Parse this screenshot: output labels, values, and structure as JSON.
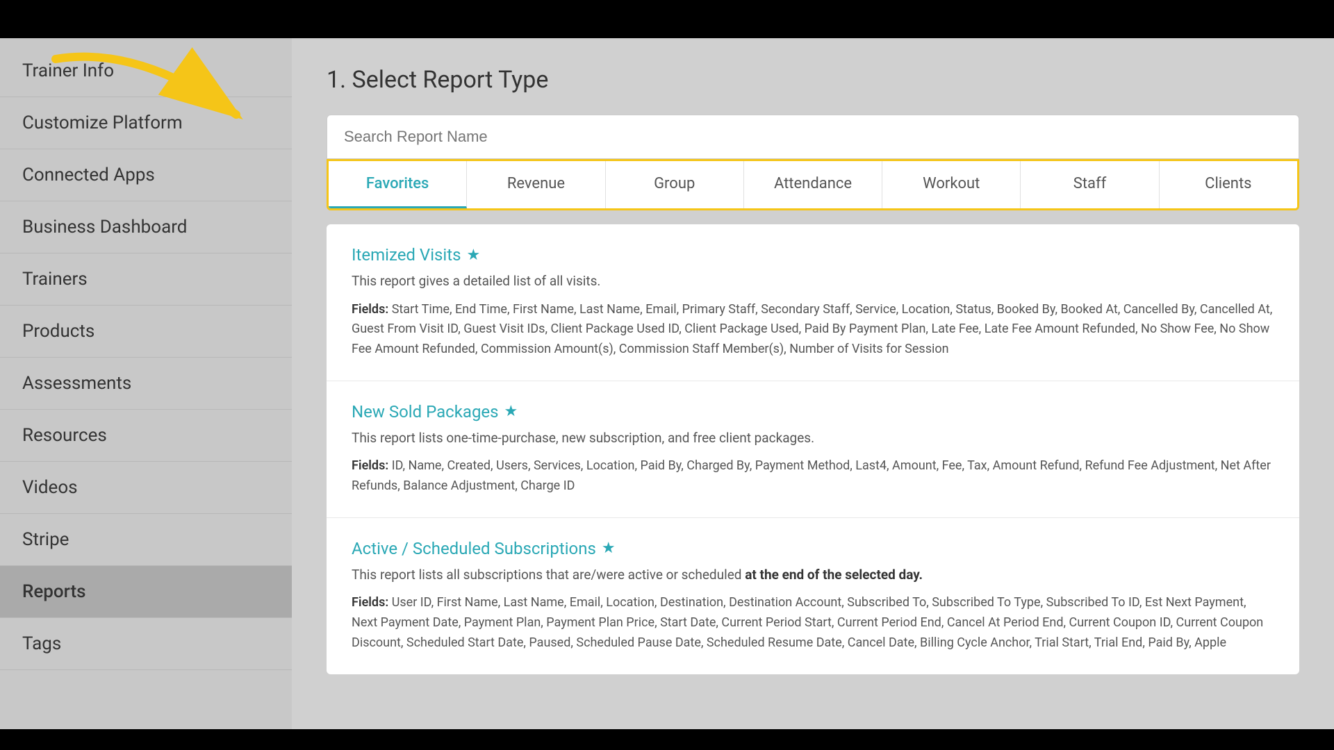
{
  "topBar": {},
  "sidebar": {
    "items": [
      {
        "id": "trainer-info",
        "label": "Trainer Info",
        "active": false
      },
      {
        "id": "customize-platform",
        "label": "Customize Platform",
        "active": false
      },
      {
        "id": "connected-apps",
        "label": "Connected Apps",
        "active": false
      },
      {
        "id": "business-dashboard",
        "label": "Business Dashboard",
        "active": false
      },
      {
        "id": "trainers",
        "label": "Trainers",
        "active": false
      },
      {
        "id": "products",
        "label": "Products",
        "active": false
      },
      {
        "id": "assessments",
        "label": "Assessments",
        "active": false
      },
      {
        "id": "resources",
        "label": "Resources",
        "active": false
      },
      {
        "id": "videos",
        "label": "Videos",
        "active": false
      },
      {
        "id": "stripe",
        "label": "Stripe",
        "active": false
      },
      {
        "id": "reports",
        "label": "Reports",
        "active": true
      },
      {
        "id": "tags",
        "label": "Tags",
        "active": false
      }
    ]
  },
  "main": {
    "pageTitle": "1. Select Report Type",
    "searchPlaceholder": "Search Report Name",
    "tabs": [
      {
        "id": "favorites",
        "label": "Favorites",
        "active": true
      },
      {
        "id": "revenue",
        "label": "Revenue",
        "active": false
      },
      {
        "id": "group",
        "label": "Group",
        "active": false
      },
      {
        "id": "attendance",
        "label": "Attendance",
        "active": false
      },
      {
        "id": "workout",
        "label": "Workout",
        "active": false
      },
      {
        "id": "staff",
        "label": "Staff",
        "active": false
      },
      {
        "id": "clients",
        "label": "Clients",
        "active": false
      }
    ],
    "reports": [
      {
        "id": "itemized-visits",
        "title": "Itemized Visits",
        "starred": true,
        "description": "This report gives a detailed list of all visits.",
        "fieldsLabel": "Fields",
        "fields": "Start Time, End Time, First Name, Last Name, Email, Primary Staff, Secondary Staff, Service, Location, Status, Booked By, Booked At, Cancelled By, Cancelled At, Guest From Visit ID, Guest Visit IDs, Client Package Used ID, Client Package Used, Paid By Payment Plan, Late Fee, Late Fee Amount Refunded, No Show Fee, No Show Fee Amount Refunded, Commission Amount(s), Commission Staff Member(s), Number of Visits for Session"
      },
      {
        "id": "new-sold-packages",
        "title": "New Sold Packages",
        "starred": true,
        "description": "This report lists one-time-purchase, new subscription, and free client packages.",
        "fieldsLabel": "Fields",
        "fields": "ID, Name, Created, Users, Services, Location, Paid By, Charged By, Payment Method, Last4, Amount, Fee, Tax, Amount Refund, Refund Fee Adjustment, Net After Refunds, Balance Adjustment, Charge ID"
      },
      {
        "id": "active-scheduled-subscriptions",
        "title": "Active / Scheduled Subscriptions",
        "starred": true,
        "descriptionPrefix": "This report lists all subscriptions that are/were active or scheduled ",
        "descriptionBold": "at the end of the selected day.",
        "fieldsLabel": "Fields",
        "fields": "User ID, First Name, Last Name, Email, Location, Destination, Destination Account, Subscribed To, Subscribed To Type, Subscribed To ID, Est Next Payment, Next Payment Date, Payment Plan, Payment Plan Price, Start Date, Current Period Start, Current Period End, Cancel At Period End, Current Coupon ID, Current Coupon Discount, Scheduled Start Date, Paused, Scheduled Pause Date, Scheduled Resume Date, Cancel Date, Billing Cycle Anchor, Trial Start, Trial End, Paid By, Apple"
      }
    ]
  }
}
